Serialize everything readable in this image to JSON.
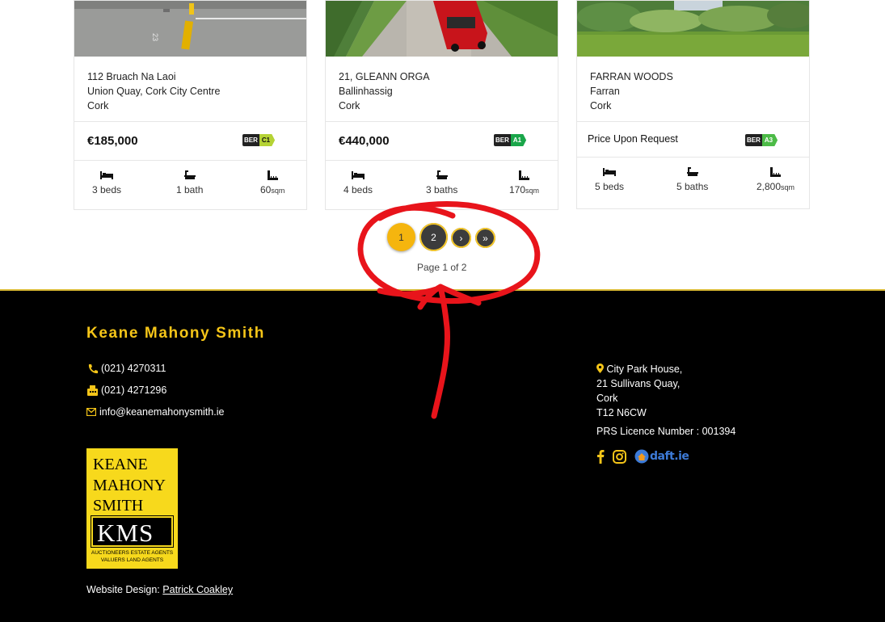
{
  "listings": [
    {
      "address": [
        "112 Bruach Na Laoi",
        "Union Quay, Cork City Centre",
        "Cork"
      ],
      "price": "€185,000",
      "ber": {
        "prefix": "BER",
        "rating": "C1",
        "color": "#b5d335"
      },
      "beds": "3 beds",
      "baths": "1 bath",
      "area": "60",
      "area_unit": "sqm",
      "photo_icon": "parking-lot-photo"
    },
    {
      "address": [
        "21, GLEANN ORGA",
        "Ballinhassig",
        "Cork"
      ],
      "price": "€440,000",
      "ber": {
        "prefix": "BER",
        "rating": "A1",
        "color": "#1aa64a"
      },
      "beds": "4 beds",
      "baths": "3 baths",
      "area": "170",
      "area_unit": "sqm",
      "photo_icon": "driveway-car-photo"
    },
    {
      "address": [
        "FARRAN WOODS",
        "Farran",
        "Cork"
      ],
      "price": "Price Upon Request",
      "ber": {
        "prefix": "BER",
        "rating": "A3",
        "color": "#4cbb47"
      },
      "beds": "5 beds",
      "baths": "5 baths",
      "area": "2,800",
      "area_unit": "sqm",
      "photo_icon": "garden-photo"
    }
  ],
  "pagination": {
    "pages": [
      "1",
      "2"
    ],
    "next": "›",
    "last": "»",
    "current": "1",
    "caption": "Page 1 of 2",
    "active_color": "#f5b50e"
  },
  "footer": {
    "brand": "Keane Mahony Smith",
    "phone": "(021) 4270311",
    "fax": "(021) 4271296",
    "email": "info@keanemahonysmith.ie",
    "address": [
      "City Park House,",
      "21 Sullivans Quay,",
      "Cork",
      "T12 N6CW"
    ],
    "licence": "PRS Licence Number : 001394",
    "socials": [
      "facebook-icon",
      "instagram-icon",
      "daft-logo"
    ],
    "daft_label": "daft.ie",
    "logo": {
      "lines": [
        "KEANE",
        "MAHONY",
        "SMITH"
      ],
      "mark": "KMS",
      "tagline": [
        "AUCTIONEERS  ESTATE AGENTS",
        "VALUERS  LAND AGENTS"
      ]
    },
    "credit_label": "Website Design:",
    "credit_link": "Patrick Coakley",
    "accent": "#f5c518"
  }
}
